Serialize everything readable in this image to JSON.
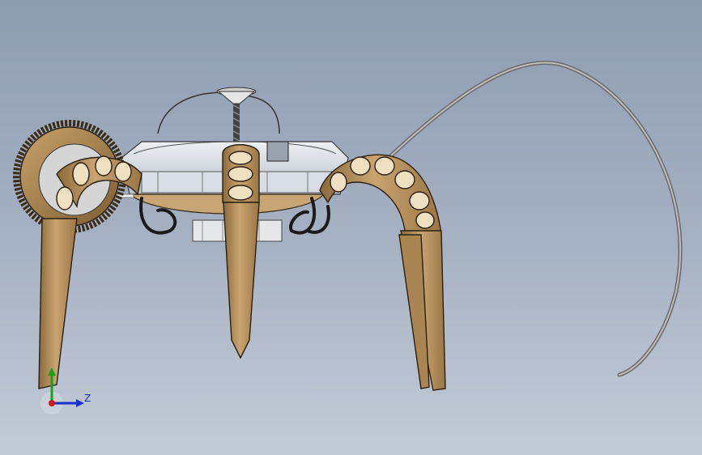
{
  "viewport": {
    "background_top": "#8e9cb1",
    "background_bottom": "#c3cbd7"
  },
  "model": {
    "description_icon": "hexapod-robot-model",
    "leg_color": "#b38f5c",
    "leg_outline": "#2a1f12",
    "body_color": "#dfe3ea",
    "cable_color": "#8d8d8d",
    "hose_color": "#1a1a1a"
  },
  "triad": {
    "z_label": "Z",
    "x_color": "#d01818",
    "y_color": "#18a018",
    "z_color": "#1a2fd0"
  }
}
